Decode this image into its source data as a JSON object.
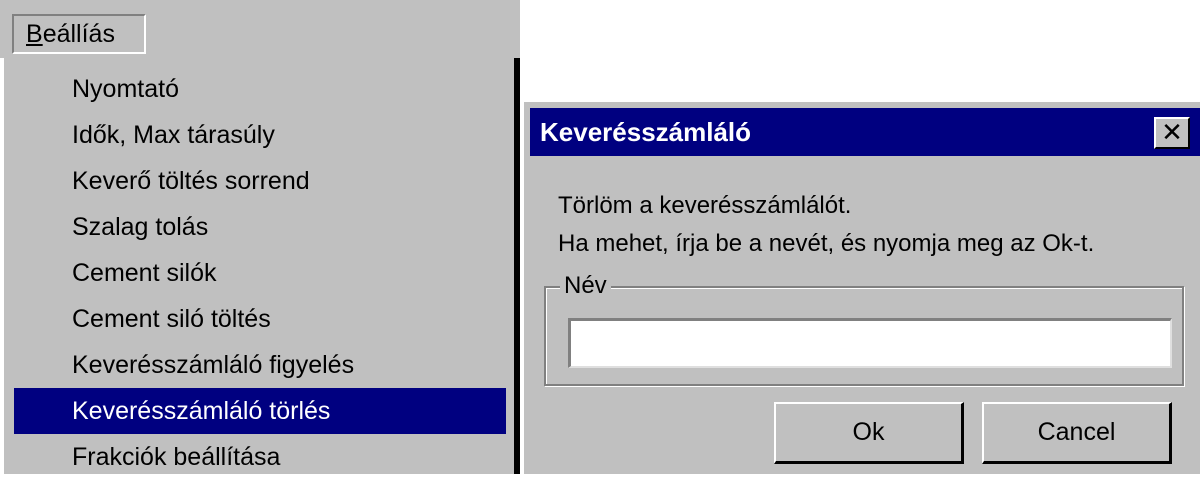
{
  "menubar": {
    "title": "Beállíás",
    "title_accel": "B",
    "title_rest": "eállíás"
  },
  "dropdown": {
    "items": [
      {
        "label": "Nyomtató"
      },
      {
        "label": "Idők, Max tárasúly"
      },
      {
        "label": "Keverő töltés sorrend"
      },
      {
        "label": "Szalag tolás"
      },
      {
        "label": "Cement silók"
      },
      {
        "label": "Cement siló töltés"
      },
      {
        "label": "Keverésszámláló figyelés"
      },
      {
        "label": "Keverésszámláló törlés",
        "selected": true
      },
      {
        "label": "Frakciók beállítása"
      }
    ]
  },
  "dialog": {
    "title": "Keverésszámláló",
    "close_glyph": "✕",
    "message_line1": "Törlöm a keverésszámlálót.",
    "message_line2": "Ha mehet, írja be a nevét, és nyomja meg az Ok-t.",
    "group_label": "Név",
    "name_value": "",
    "ok_label": "Ok",
    "cancel_label": "Cancel"
  },
  "colors": {
    "face": "#c0c0c0",
    "selection": "#000080",
    "titlebar": "#000080"
  }
}
